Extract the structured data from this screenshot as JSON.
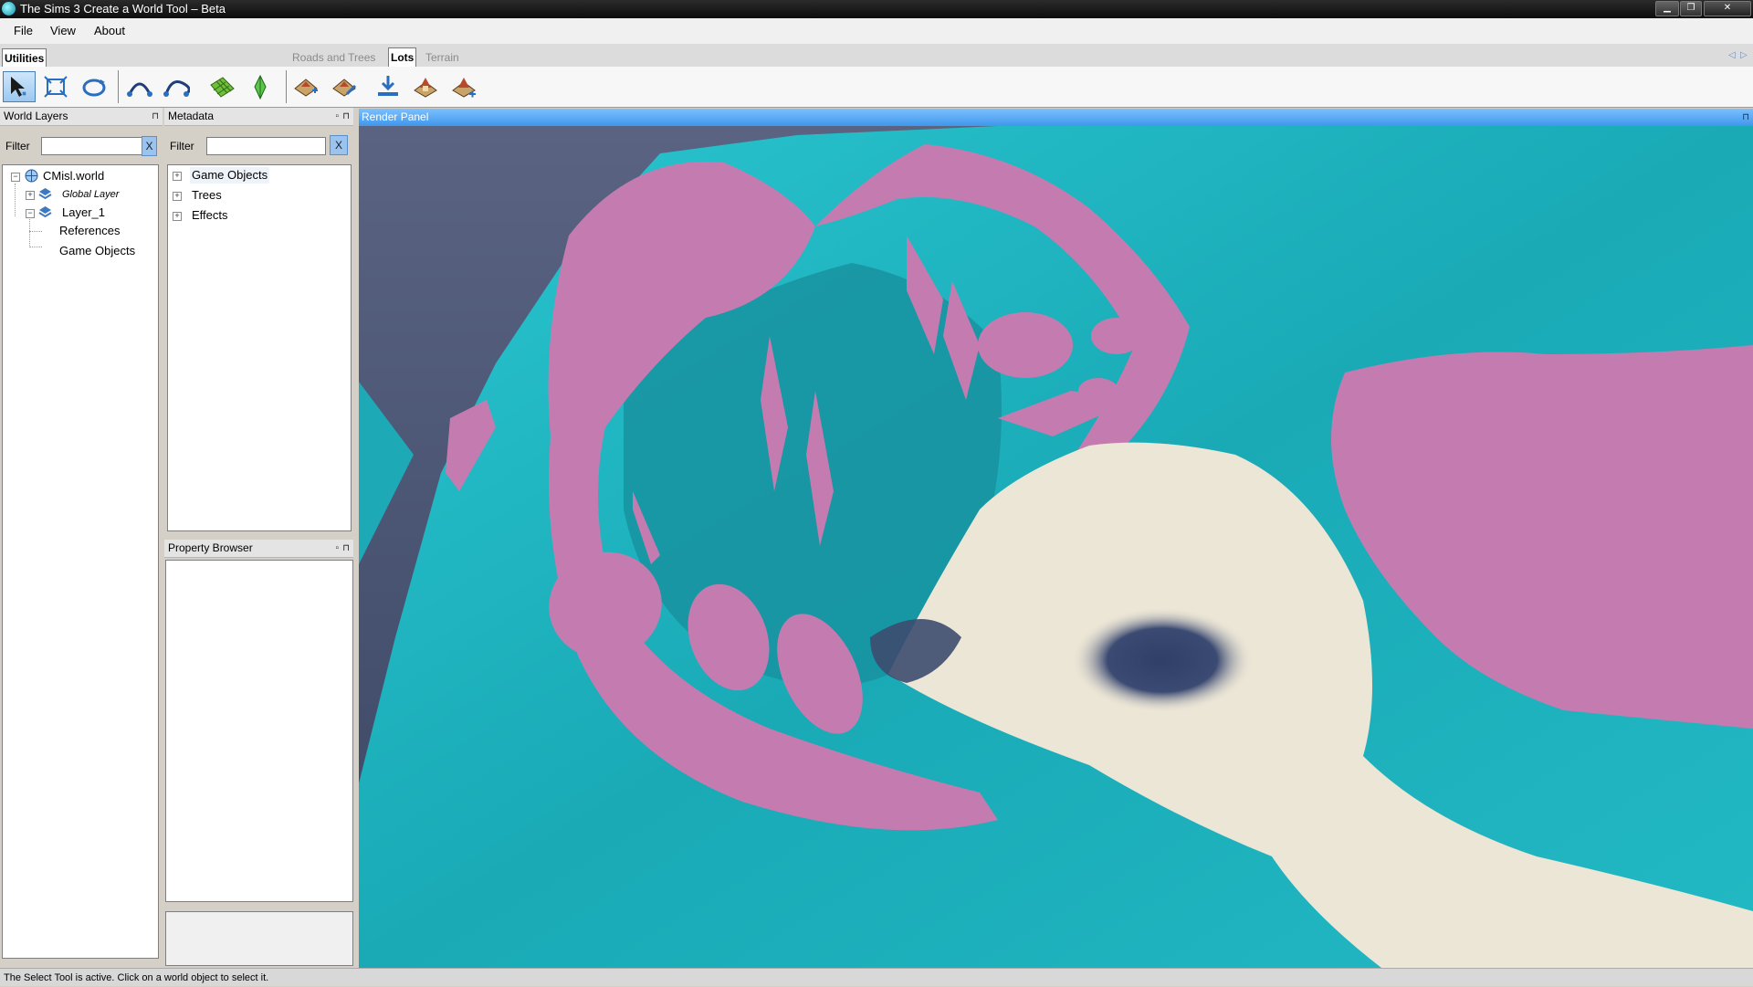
{
  "window": {
    "title": "The Sims 3 Create a World Tool – Beta"
  },
  "menu": {
    "items": [
      "File",
      "View",
      "About"
    ]
  },
  "tabs": {
    "utilities": "Utilities",
    "roads_and_trees": "Roads and Trees",
    "lots": "Lots",
    "terrain": "Terrain",
    "active": "Lots"
  },
  "toolbar": {
    "icons": [
      "select-icon",
      "move-icon",
      "rotate-icon",
      "road-curve-icon",
      "road-bend-icon",
      "terrain-grid-icon",
      "plumbob-icon",
      "lot-add-icon",
      "lot-edit-icon",
      "lot-import-icon",
      "lot-house-icon",
      "lot-house-add-icon"
    ]
  },
  "world_layers": {
    "title": "World Layers",
    "filter_label": "Filter",
    "filter_value": "",
    "tree": {
      "root": "CMisl.world",
      "global_layer": "Global Layer",
      "layer1": "Layer_1",
      "references": "References",
      "game_objects": "Game Objects"
    }
  },
  "metadata": {
    "title": "Metadata",
    "filter_label": "Filter",
    "filter_value": "",
    "clear_label": "X",
    "items": [
      "Game Objects",
      "Trees",
      "Effects"
    ]
  },
  "property_browser": {
    "title": "Property Browser"
  },
  "render_panel": {
    "title": "Render Panel"
  },
  "status": {
    "text": "The Select Tool is active. Click on a world object to select it."
  },
  "colors": {
    "terrain_cyan": "#1fbcc8",
    "lot_pink": "#c47cb0",
    "sand": "#ece6d6",
    "water": "#3f4c6a",
    "render_header": "#3f97ec"
  }
}
